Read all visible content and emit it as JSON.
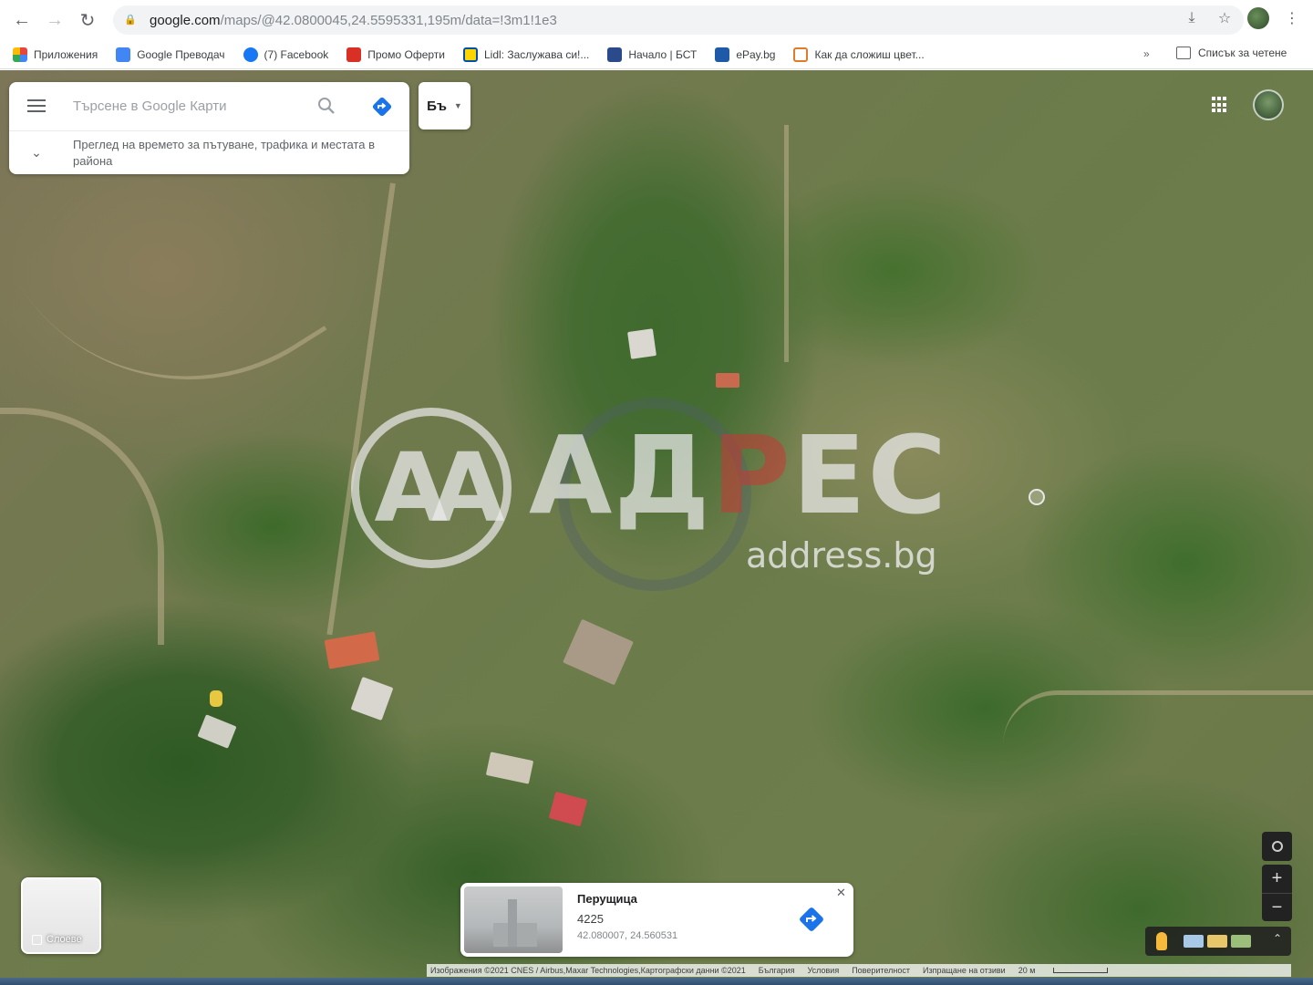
{
  "browser": {
    "url_domain": "google.com",
    "url_path": "/maps/@42.0800045,24.5595331,195m/data=!3m1!1e3",
    "bookmarks": [
      {
        "label": "Приложения",
        "color": "#e8453c"
      },
      {
        "label": "Google Преводач",
        "color": "#4285f4"
      },
      {
        "label": "(7) Facebook",
        "color": "#1877f2"
      },
      {
        "label": "Промо Оферти",
        "color": "#d93025"
      },
      {
        "label": "Lidl: Заслужава си!...",
        "color": "#ffd500"
      },
      {
        "label": "Начало | БСТ",
        "color": "#2b4a8b"
      },
      {
        "label": "ePay.bg",
        "color": "#1e5aa8"
      },
      {
        "label": "Как да сложиш цвет...",
        "color": "#e07b2a"
      }
    ],
    "bookmarks_more": "»",
    "reading_list": "Списък за четене"
  },
  "search": {
    "placeholder": "Търсене в Google Карти",
    "hint": "Преглед на времето за пътуване, трафика и местата в района"
  },
  "language_button": "Бъ",
  "watermark": {
    "logo": "AA",
    "text_before": "АД",
    "text_accent": "Р",
    "text_after": "ЕС",
    "sub": "address.bg"
  },
  "place": {
    "name": "Перущица",
    "postal_code": "4225",
    "coords": "42.080007, 24.560531"
  },
  "layers_label": "Слоеве",
  "attribution": {
    "imagery": "Изображения ©2021 CNES / Airbus,Maxar Technologies,Картографски данни ©2021",
    "items": [
      "България",
      "Условия",
      "Поверителност",
      "Изпращане на отзиви"
    ],
    "scale": "20 м"
  },
  "colors": {
    "accent": "#1a73e8",
    "map_grass": "#6b7c4a",
    "map_trees": "#3f6a2e"
  }
}
